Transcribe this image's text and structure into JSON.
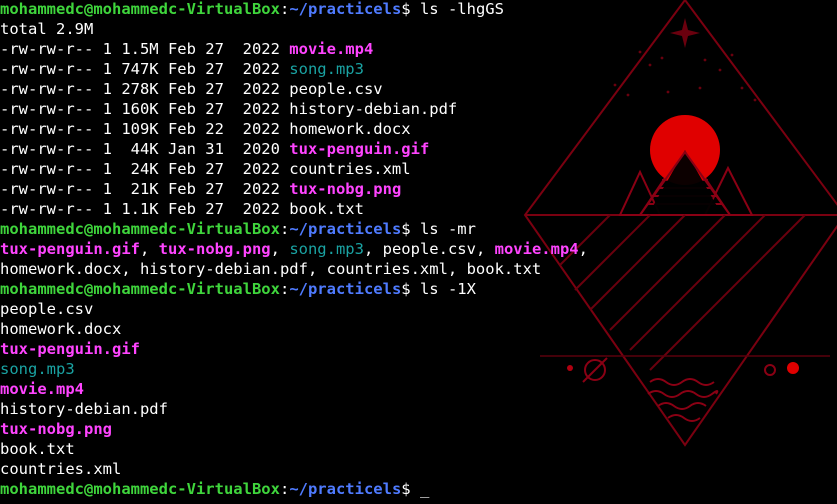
{
  "window": {
    "title": "mohammedc@mohammedc-VirtualBox: ~/practicels"
  },
  "theme": {
    "background": "#000000",
    "text": "#ffffff",
    "prompt_user": "#3fd53c",
    "prompt_path": "#4f7bff",
    "media_file": "#ff44ff",
    "audio_file": "#1aa3a3",
    "wallpaper_accent": "#e00000",
    "wallpaper_line": "#7a0010"
  },
  "wallpaper": {
    "type": "red geometric mountain and sun line art",
    "icons": [
      "diamond-frame-icon",
      "sun-icon",
      "mountain-icon",
      "star-icon",
      "planet-icon"
    ]
  },
  "prompt": {
    "user_host": "mohammedc@mohammedc-VirtualBox",
    "colon": ":",
    "path": "~/practicels",
    "symbol": "$"
  },
  "lines": [
    {
      "kind": "prompt",
      "command": " ls -lhgGS"
    },
    {
      "kind": "text",
      "segments": [
        {
          "text": "total 2.9M",
          "style": "white"
        }
      ]
    },
    {
      "kind": "text",
      "segments": [
        {
          "text": "-rw-rw-r-- 1 1.5M Feb 27  2022 ",
          "style": "white"
        },
        {
          "text": "movie.mp4",
          "style": "pink"
        }
      ]
    },
    {
      "kind": "text",
      "segments": [
        {
          "text": "-rw-rw-r-- 1 747K Feb 27  2022 ",
          "style": "white"
        },
        {
          "text": "song.mp3",
          "style": "teal"
        }
      ]
    },
    {
      "kind": "text",
      "segments": [
        {
          "text": "-rw-rw-r-- 1 278K Feb 27  2022 people.csv",
          "style": "white"
        }
      ]
    },
    {
      "kind": "text",
      "segments": [
        {
          "text": "-rw-rw-r-- 1 160K Feb 27  2022 history-debian.pdf",
          "style": "white"
        }
      ]
    },
    {
      "kind": "text",
      "segments": [
        {
          "text": "-rw-rw-r-- 1 109K Feb 22  2022 homework.docx",
          "style": "white"
        }
      ]
    },
    {
      "kind": "text",
      "segments": [
        {
          "text": "-rw-rw-r-- 1  44K Jan 31  2020 ",
          "style": "white"
        },
        {
          "text": "tux-penguin.gif",
          "style": "pink"
        }
      ]
    },
    {
      "kind": "text",
      "segments": [
        {
          "text": "-rw-rw-r-- 1  24K Feb 27  2022 countries.xml",
          "style": "white"
        }
      ]
    },
    {
      "kind": "text",
      "segments": [
        {
          "text": "-rw-rw-r-- 1  21K Feb 27  2022 ",
          "style": "white"
        },
        {
          "text": "tux-nobg.png",
          "style": "pink"
        }
      ]
    },
    {
      "kind": "text",
      "segments": [
        {
          "text": "-rw-rw-r-- 1 1.1K Feb 27  2022 book.txt",
          "style": "white"
        }
      ]
    },
    {
      "kind": "prompt",
      "command": " ls -mr"
    },
    {
      "kind": "text",
      "segments": [
        {
          "text": "tux-penguin.gif",
          "style": "pink"
        },
        {
          "text": ", ",
          "style": "white"
        },
        {
          "text": "tux-nobg.png",
          "style": "pink"
        },
        {
          "text": ", ",
          "style": "white"
        },
        {
          "text": "song.mp3",
          "style": "teal"
        },
        {
          "text": ", people.csv, ",
          "style": "white"
        },
        {
          "text": "movie.mp4",
          "style": "pink"
        },
        {
          "text": ",",
          "style": "white"
        }
      ]
    },
    {
      "kind": "text",
      "segments": [
        {
          "text": "homework.docx, history-debian.pdf, countries.xml, book.txt",
          "style": "white"
        }
      ]
    },
    {
      "kind": "prompt",
      "command": " ls -1X"
    },
    {
      "kind": "text",
      "segments": [
        {
          "text": "people.csv",
          "style": "white"
        }
      ]
    },
    {
      "kind": "text",
      "segments": [
        {
          "text": "homework.docx",
          "style": "white"
        }
      ]
    },
    {
      "kind": "text",
      "segments": [
        {
          "text": "tux-penguin.gif",
          "style": "pink"
        }
      ]
    },
    {
      "kind": "text",
      "segments": [
        {
          "text": "song.mp3",
          "style": "teal"
        }
      ]
    },
    {
      "kind": "text",
      "segments": [
        {
          "text": "movie.mp4",
          "style": "pink"
        }
      ]
    },
    {
      "kind": "text",
      "segments": [
        {
          "text": "history-debian.pdf",
          "style": "white"
        }
      ]
    },
    {
      "kind": "text",
      "segments": [
        {
          "text": "tux-nobg.png",
          "style": "pink"
        }
      ]
    },
    {
      "kind": "text",
      "segments": [
        {
          "text": "book.txt",
          "style": "white"
        }
      ]
    },
    {
      "kind": "text",
      "segments": [
        {
          "text": "countries.xml",
          "style": "white"
        }
      ]
    },
    {
      "kind": "prompt",
      "command": " ",
      "cursor": "_"
    }
  ]
}
